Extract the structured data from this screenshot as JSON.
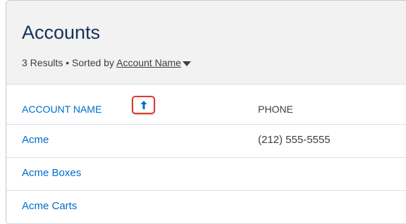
{
  "header": {
    "title": "Accounts",
    "result_count": "3 Results",
    "separator": "•",
    "sorted_by_label": "Sorted by",
    "sort_field": "Account Name"
  },
  "columns": {
    "account_name": "ACCOUNT NAME",
    "phone": "PHONE",
    "sort_direction": "ascending",
    "sort_icon": "arrow-up-icon"
  },
  "rows": [
    {
      "name": "Acme",
      "phone": "(212) 555-5555"
    },
    {
      "name": "Acme Boxes",
      "phone": ""
    },
    {
      "name": "Acme Carts",
      "phone": ""
    }
  ],
  "colors": {
    "link": "#006dcc",
    "title": "#16325c",
    "highlight": "#e0392c",
    "header_bg": "#f3f2f2"
  }
}
